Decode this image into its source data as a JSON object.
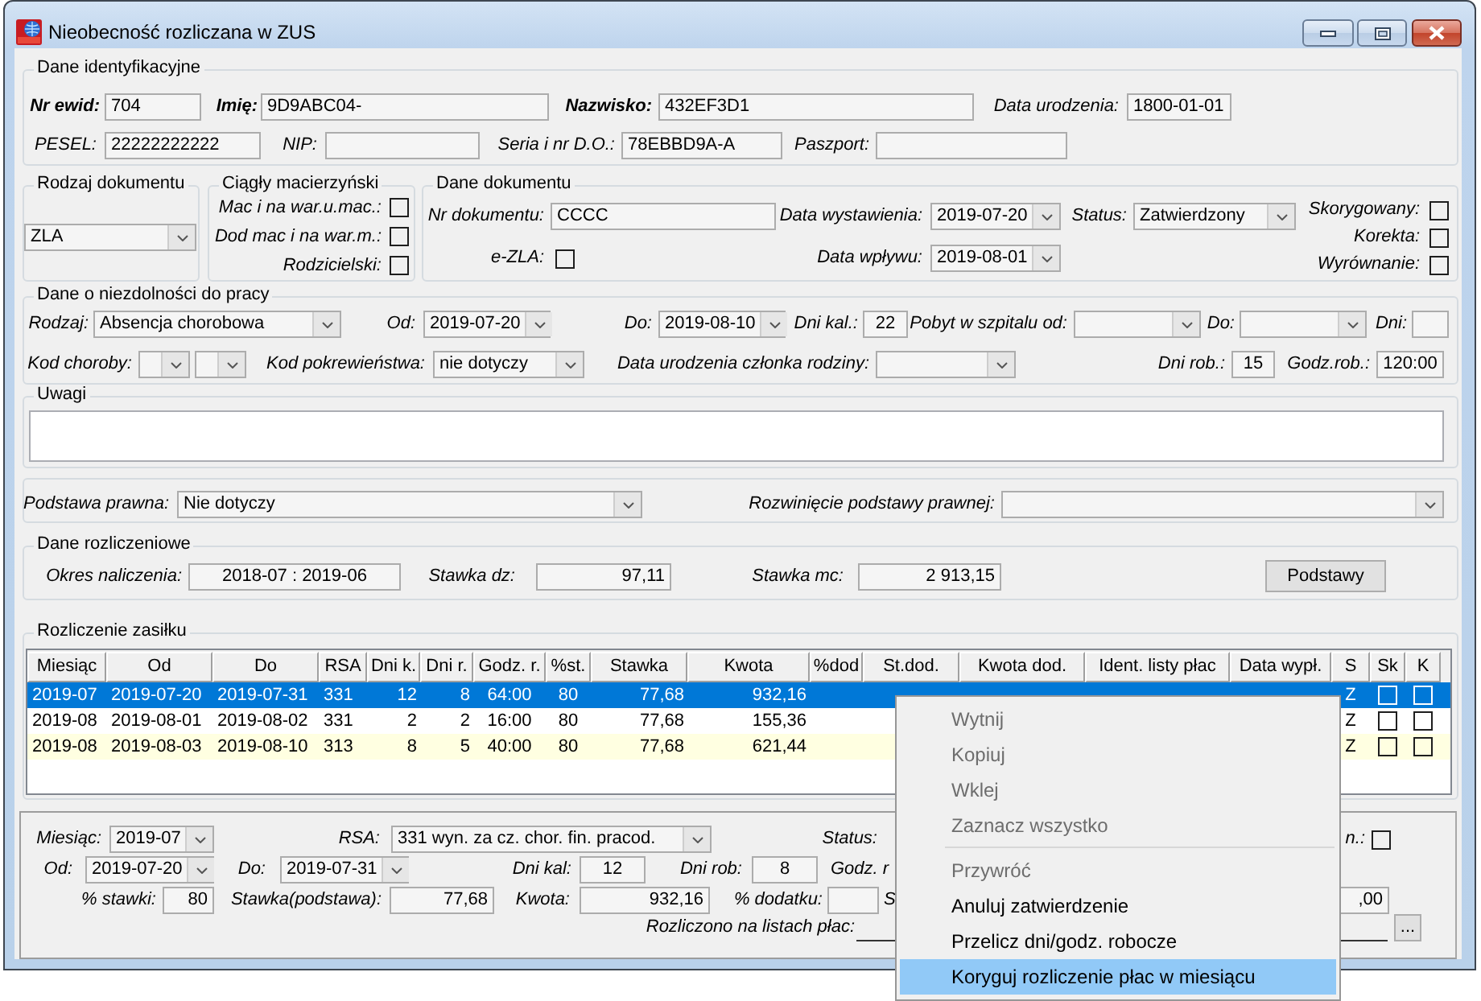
{
  "window": {
    "title": "Nieobecność rozliczana w ZUS"
  },
  "identification": {
    "legend": "Dane identyfikacyjne",
    "lines": [
      {
        "fields": [
          {
            "kind": "field",
            "label": "Nr ewid:",
            "bold": true,
            "value": "704"
          },
          {
            "kind": "field",
            "label": "Imię:",
            "bold": true,
            "value": "9D9ABC04-"
          },
          {
            "kind": "field",
            "label": "Nazwisko:",
            "bold": true,
            "value": "432EF3D1"
          },
          {
            "kind": "field",
            "label": "Data urodzenia:",
            "bold": false,
            "value": "1800-01-01"
          }
        ]
      },
      {
        "fields": [
          {
            "kind": "field",
            "label": "PESEL:",
            "bold": false,
            "value": "22222222222"
          },
          {
            "kind": "field",
            "label": "NIP:",
            "bold": false
          },
          {
            "kind": "field",
            "label": "Seria i nr D.O.:",
            "bold": false,
            "value": "78EBBD9A-A"
          },
          {
            "kind": "field",
            "label": "Paszport:",
            "bold": false
          }
        ]
      }
    ]
  },
  "document_type": {
    "legend": "Rodzaj dokumentu",
    "value": "ZLA"
  },
  "continuous_maternity": {
    "legend": "Ciągły macierzyński",
    "options": [
      {
        "label": "Mac i na war.u.mac.:",
        "checked": false
      },
      {
        "label": "Dod mac i na war.m.:",
        "checked": false
      },
      {
        "label": "Rodzicielski:",
        "checked": false
      }
    ]
  },
  "document_data": {
    "legend": "Dane dokumentu",
    "lines": [
      {
        "fields": [
          {
            "kind": "field",
            "label": "Nr dokumentu:",
            "value": "CCCC"
          },
          {
            "kind": "dropdown",
            "label": "Data wystawienia:",
            "value": "2019-07-20"
          },
          {
            "kind": "dropdown",
            "label": "Status:",
            "value": "Zatwierdzony"
          }
        ]
      },
      {
        "fields": [
          {
            "kind": "checkbox",
            "label": "e-ZLA:",
            "checked": false
          },
          {
            "kind": "dropdown",
            "label": "Data wpływu:",
            "value": "2019-08-01"
          }
        ]
      }
    ],
    "flags": [
      {
        "label": "Skorygowany:",
        "checked": false
      },
      {
        "label": "Korekta:",
        "checked": false
      },
      {
        "label": "Wyrównanie:",
        "checked": false
      }
    ]
  },
  "incapacity": {
    "legend": "Dane o niezdolności do pracy",
    "lines": [
      {
        "fields": [
          {
            "kind": "dropdown",
            "label": "Rodzaj:",
            "value": "Absencja chorobowa"
          },
          {
            "kind": "dropdown",
            "label": "Od:",
            "value": "2019-07-20"
          },
          {
            "kind": "dropdown",
            "label": "Do:",
            "value": "2019-08-10"
          },
          {
            "kind": "field",
            "label": "Dni kal.:",
            "value": "22"
          },
          {
            "kind": "dropdown",
            "label": "Pobyt w szpitalu od:"
          },
          {
            "kind": "dropdown",
            "label": "Do:"
          },
          {
            "kind": "field",
            "label": "Dni:"
          }
        ]
      },
      {
        "fields": [
          {
            "kind": "dropdown",
            "label": "Kod choroby:"
          },
          {
            "kind": "dropdown"
          },
          {
            "kind": "dropdown",
            "label": "Kod pokrewieństwa:",
            "value": "nie dotyczy"
          },
          {
            "kind": "dropdown",
            "label": "Data urodzenia członka rodziny:"
          },
          {
            "kind": "field",
            "label": "Dni rob.:",
            "value": "15"
          },
          {
            "kind": "field",
            "label": "Godz.rob.:",
            "value": "120:00"
          }
        ]
      }
    ]
  },
  "remarks": {
    "legend": "Uwagi"
  },
  "legal_basis": {
    "lines": [
      {
        "fields": [
          {
            "kind": "dropdown",
            "label": "Podstawa prawna:",
            "value": "Nie dotyczy"
          },
          {
            "kind": "dropdown",
            "label": "Rozwinięcie podstawy prawnej:"
          }
        ]
      }
    ]
  },
  "settlement": {
    "legend": "Dane rozliczeniowe",
    "lines": [
      {
        "fields": [
          {
            "kind": "field",
            "label": "Okres naliczenia:",
            "value": "2018-07 : 2019-06"
          },
          {
            "kind": "field",
            "label": "Stawka dz:",
            "value": "97,11"
          },
          {
            "kind": "field",
            "label": "Stawka mc:",
            "value": "2 913,15"
          },
          {
            "kind": "button",
            "label": "Podstawy"
          }
        ]
      }
    ]
  },
  "benefit_table": {
    "legend": "Rozliczenie zasiłku",
    "columns": [
      "Miesiąc",
      "Od",
      "Do",
      "RSA",
      "Dni k.",
      "Dni r.",
      "Godz. r.",
      "%st.",
      "Stawka",
      "Kwota",
      "%dod",
      "St.dod.",
      "Kwota dod.",
      "Ident. listy płac",
      "Data wypł.",
      "S",
      "Sk",
      "K"
    ],
    "rows": [
      {
        "selected": true,
        "highlighted": false,
        "month": "2019-07",
        "from": "2019-07-20",
        "to": "2019-07-31",
        "rsa": "331",
        "calendar_days": "12",
        "work_days": "8",
        "work_hours": "64:00",
        "rate_percent": "80",
        "rate": "77,68",
        "amount": "932,16",
        "s": "Z",
        "sk": false,
        "k": false
      },
      {
        "selected": false,
        "highlighted": false,
        "month": "2019-08",
        "from": "2019-08-01",
        "to": "2019-08-02",
        "rsa": "331",
        "calendar_days": "2",
        "work_days": "2",
        "work_hours": "16:00",
        "rate_percent": "80",
        "rate": "77,68",
        "amount": "155,36",
        "s": "Z",
        "sk": false,
        "k": false
      },
      {
        "selected": false,
        "highlighted": true,
        "month": "2019-08",
        "from": "2019-08-03",
        "to": "2019-08-10",
        "rsa": "313",
        "calendar_days": "8",
        "work_days": "5",
        "work_hours": "40:00",
        "rate_percent": "80",
        "rate": "77,68",
        "amount": "621,44",
        "s": "Z",
        "sk": false,
        "k": false
      }
    ]
  },
  "detail": {
    "lines": [
      {
        "fields": [
          {
            "kind": "dropdown",
            "label": "Miesiąc:",
            "value": "2019-07"
          },
          {
            "kind": "dropdown",
            "label": "RSA:",
            "value": "331 wyn. za cz. chor. fin. pracod."
          },
          {
            "kind": "label",
            "label": "Status:"
          },
          {
            "kind": "checkbox",
            "label": "n.:",
            "checked": false
          }
        ]
      },
      {
        "fields": [
          {
            "kind": "dropdown",
            "label": "Od:",
            "value": "2019-07-20"
          },
          {
            "kind": "dropdown",
            "label": "Do:",
            "value": "2019-07-31"
          },
          {
            "kind": "field",
            "label": "Dni kal:",
            "value": "12"
          },
          {
            "kind": "field",
            "label": "Dni rob:",
            "value": "8"
          },
          {
            "kind": "label",
            "label": "Godz. r"
          }
        ]
      },
      {
        "fields": [
          {
            "kind": "field",
            "label": "% stawki:",
            "value": "80"
          },
          {
            "kind": "field",
            "label": "Stawka(podstawa):",
            "value": "77,68"
          },
          {
            "kind": "field",
            "label": "Kwota:",
            "value": "932,16"
          },
          {
            "kind": "field",
            "label": "% dodatku:"
          },
          {
            "kind": "label",
            "label": "S"
          },
          {
            "kind": "field",
            "value": ",00"
          }
        ]
      },
      {
        "fields": [
          {
            "kind": "line",
            "label": "Rozliczono na listach płac:"
          },
          {
            "kind": "button",
            "label": "..."
          }
        ]
      }
    ]
  },
  "context_menu": {
    "items": [
      {
        "kind": "item",
        "label": "Wytnij",
        "disabled": true,
        "selected": false
      },
      {
        "kind": "item",
        "label": "Kopiuj",
        "disabled": true,
        "selected": false
      },
      {
        "kind": "item",
        "label": "Wklej",
        "disabled": true,
        "selected": false
      },
      {
        "kind": "item",
        "label": "Zaznacz wszystko",
        "disabled": true,
        "selected": false
      },
      {
        "kind": "separator"
      },
      {
        "kind": "item",
        "label": "Przywróć",
        "disabled": true,
        "selected": false
      },
      {
        "kind": "item",
        "label": "Anuluj zatwierdzenie",
        "disabled": false,
        "selected": false
      },
      {
        "kind": "item",
        "label": "Przelicz dni/godz. robocze",
        "disabled": false,
        "selected": false
      },
      {
        "kind": "item",
        "label": "Koryguj rozliczenie płac w miesiącu",
        "disabled": false,
        "selected": true
      }
    ]
  }
}
